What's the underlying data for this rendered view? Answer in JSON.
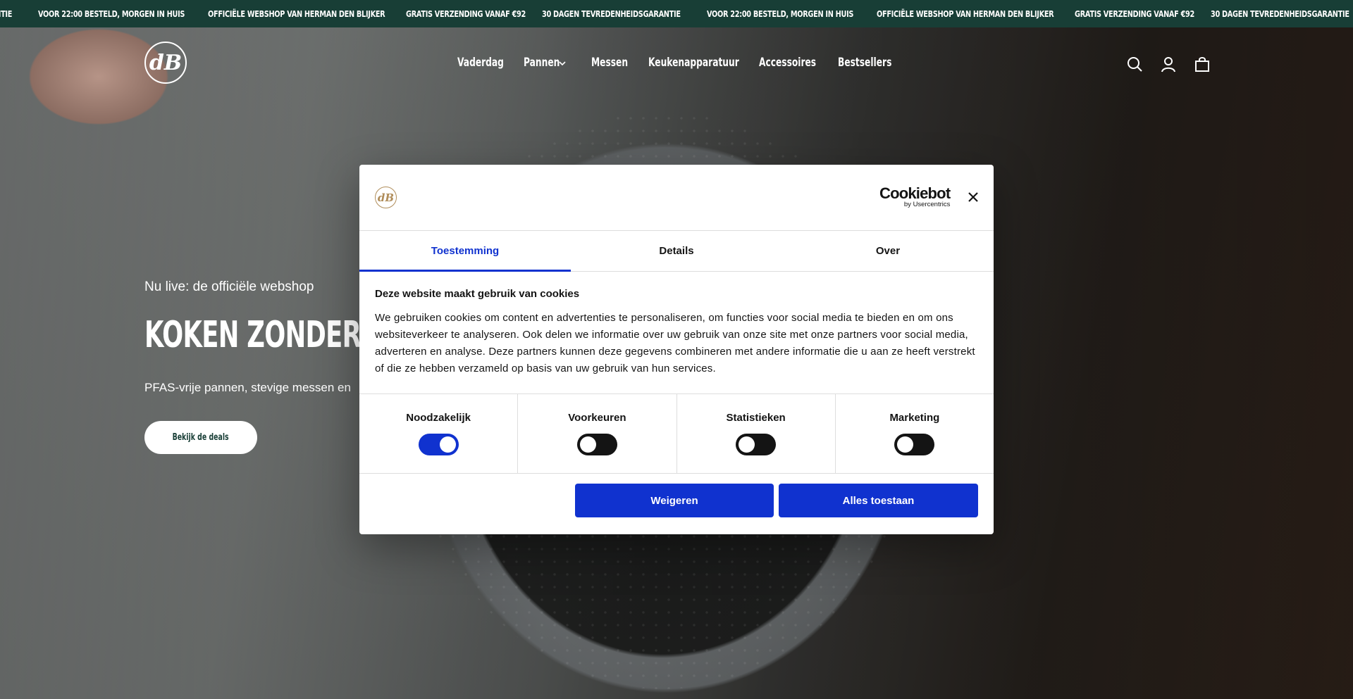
{
  "announcement": {
    "items": [
      "antie",
      "Voor 22:00 besteld, morgen in huis",
      "Officiële webshop van Herman den Blijker",
      "Gratis verzending vanaf €92",
      "30 dagen tevredenheidsgarantie",
      "Voor 22:00 besteld, morgen in huis",
      "Officiële webshop van Herman den Blijker",
      "Gratis verzending vanaf €92",
      "30 dagen tevredenheidsgarantie"
    ]
  },
  "header": {
    "logo_text": "dB",
    "nav": [
      "Vaderdag",
      "Pannen",
      "Messen",
      "Keukenapparatuur",
      "Accessoires",
      "Bestsellers"
    ],
    "icons": [
      "search-icon",
      "account-icon",
      "cart-icon"
    ]
  },
  "hero": {
    "eyebrow": "Nu live: de officiële webshop",
    "headline": "Koken zonder ged",
    "subline": "PFAS-vrije pannen, stevige messen en",
    "cta": "Bekijk de deals"
  },
  "cookie_dialog": {
    "logo_text": "dB",
    "brand": "Cookiebot",
    "brand_sub": "by Usercentrics",
    "tabs": [
      "Toestemming",
      "Details",
      "Over"
    ],
    "active_tab": "Toestemming",
    "title": "Deze website maakt gebruik van cookies",
    "body": "We gebruiken cookies om content en advertenties te personaliseren, om functies voor social media te bieden en om ons websiteverkeer te analyseren. Ook delen we informatie over uw gebruik van onze site met onze partners voor social media, adverteren en analyse. Deze partners kunnen deze gegevens combineren met andere informatie die u aan ze heeft verstrekt of die ze hebben verzameld op basis van uw gebruik van hun services.",
    "toggles": [
      {
        "label": "Noodzakelijk",
        "on": true
      },
      {
        "label": "Voorkeuren",
        "on": false
      },
      {
        "label": "Statistieken",
        "on": false
      },
      {
        "label": "Marketing",
        "on": false
      }
    ],
    "decline_label": "Weigeren",
    "accept_label": "Alles toestaan",
    "accent_color": "#1032cf"
  },
  "colors": {
    "announcement_bg": "#183e36",
    "accent": "#1032cf"
  }
}
